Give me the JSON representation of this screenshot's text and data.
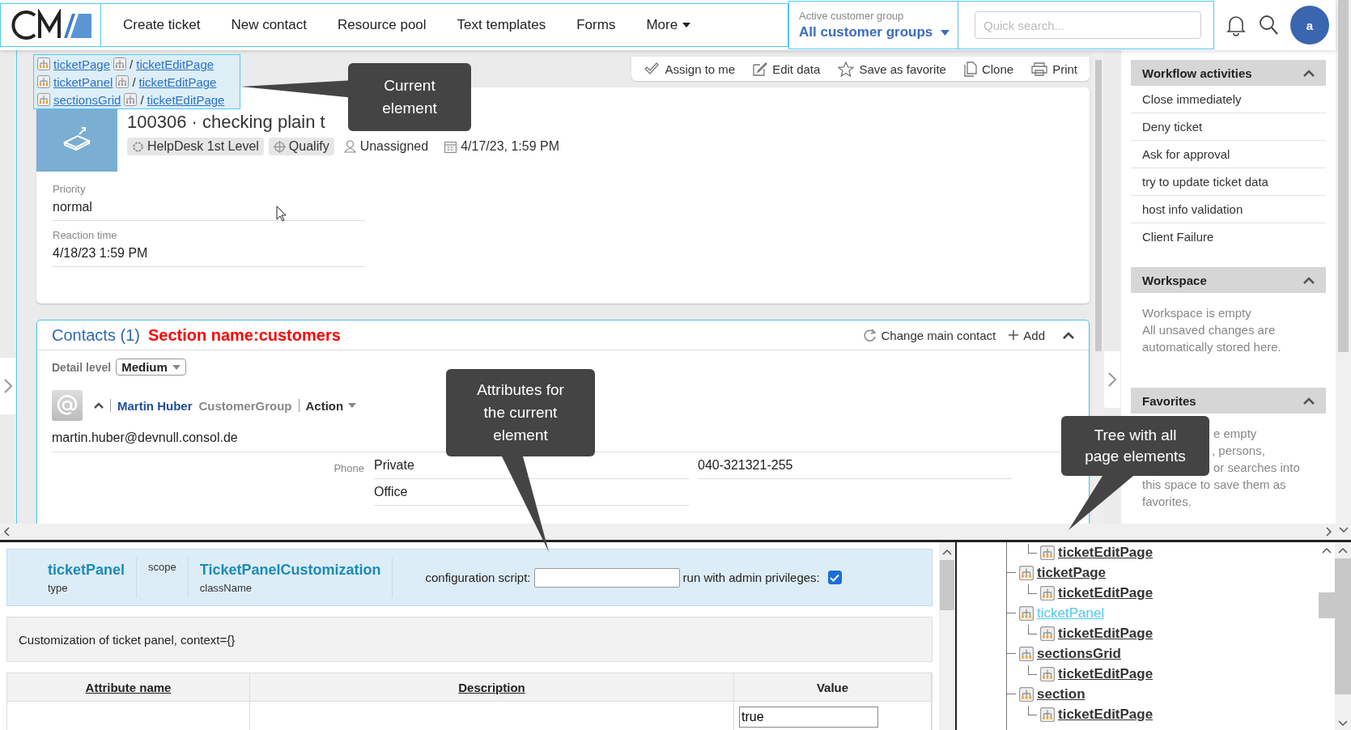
{
  "nav": {
    "items": [
      "Create ticket",
      "New contact",
      "Resource pool",
      "Text templates",
      "Forms"
    ],
    "more": "More"
  },
  "customer_group": {
    "label": "Active customer group",
    "value": "All customer groups"
  },
  "search": {
    "placeholder": "Quick search..."
  },
  "avatar": "a",
  "breadcrumbs": [
    {
      "element": "ticketPage",
      "separator": "/",
      "parent": "ticketEditPage"
    },
    {
      "element": "ticketPanel",
      "separator": "/",
      "parent": "ticketEditPage"
    },
    {
      "element": "sectionsGrid",
      "separator": "/",
      "parent": "ticketEditPage"
    }
  ],
  "toolbar": [
    "Assign to me",
    "Edit data",
    "Save as favorite",
    "Clone",
    "Print"
  ],
  "ticket": {
    "title": "100306 ·  checking plain t",
    "tags": [
      {
        "kind": "chip",
        "label": "HelpDesk 1st Level"
      },
      {
        "kind": "chip",
        "label": "Qualify"
      },
      {
        "kind": "plain",
        "label": "Unassigned"
      },
      {
        "kind": "plain",
        "label": "4/17/23, 1:59 PM"
      }
    ],
    "fields": [
      {
        "label": "Priority",
        "value": "normal"
      },
      {
        "label": "Reaction time",
        "value": "4/18/23 1:59 PM"
      }
    ]
  },
  "contacts": {
    "title": "Contacts (1)",
    "section_name": "Section name:customers",
    "actions": [
      "Change main contact",
      "Add"
    ],
    "detail_level": {
      "label": "Detail level",
      "value": "Medium"
    },
    "contact": {
      "name": "Martin Huber",
      "group": "CustomerGroup",
      "action": "Action",
      "email": "martin.huber@devnull.consol.de"
    },
    "phone": {
      "label": "Phone",
      "rows": [
        {
          "type": "Private",
          "number": "040-321321-255"
        },
        {
          "type": "Office"
        }
      ]
    }
  },
  "sidebar": {
    "workflow": {
      "title": "Workflow activities",
      "items": [
        "Close immediately",
        "Deny ticket",
        "Ask for approval",
        "try to update ticket data",
        "host info validation",
        "Client Failure"
      ]
    },
    "workspace": {
      "title": "Workspace",
      "lines": [
        "Workspace is empty",
        "All unsaved changes are",
        "automatically stored here."
      ]
    },
    "favorites": {
      "title": "Favorites",
      "lines": [
        "e empty",
        ", persons,",
        "or searches into",
        "this space to save them as",
        "favorites."
      ]
    }
  },
  "callouts": [
    "Current element",
    "Attributes for the current element",
    "Tree with all page elements"
  ],
  "attributes": {
    "type_value": "ticketPanel",
    "type_label": "type",
    "scope_label": "scope",
    "class_value": "TicketPanelCustomization",
    "class_label": "className",
    "script_label": "configuration script:",
    "admin_label": "run with admin privileges:",
    "admin_checked": true,
    "description": "Customization of ticket panel, context={}",
    "columns": [
      "Attribute name",
      "Description",
      "Value"
    ],
    "rows": [
      {
        "value": "true"
      }
    ]
  },
  "tree": [
    {
      "children": [
        {
          "label": "ticketEditPage",
          "selected": false
        }
      ]
    },
    {
      "label": "ticketPage",
      "selected": false,
      "children": [
        {
          "label": "ticketEditPage",
          "selected": false
        }
      ]
    },
    {
      "label": "ticketPanel",
      "selected": true,
      "children": [
        {
          "label": "ticketEditPage",
          "selected": false
        }
      ]
    },
    {
      "label": "sectionsGrid",
      "selected": false,
      "children": [
        {
          "label": "ticketEditPage",
          "selected": false
        }
      ]
    },
    {
      "label": "section",
      "selected": false,
      "children": [
        {
          "label": "ticketEditPage",
          "selected": false
        }
      ]
    }
  ]
}
